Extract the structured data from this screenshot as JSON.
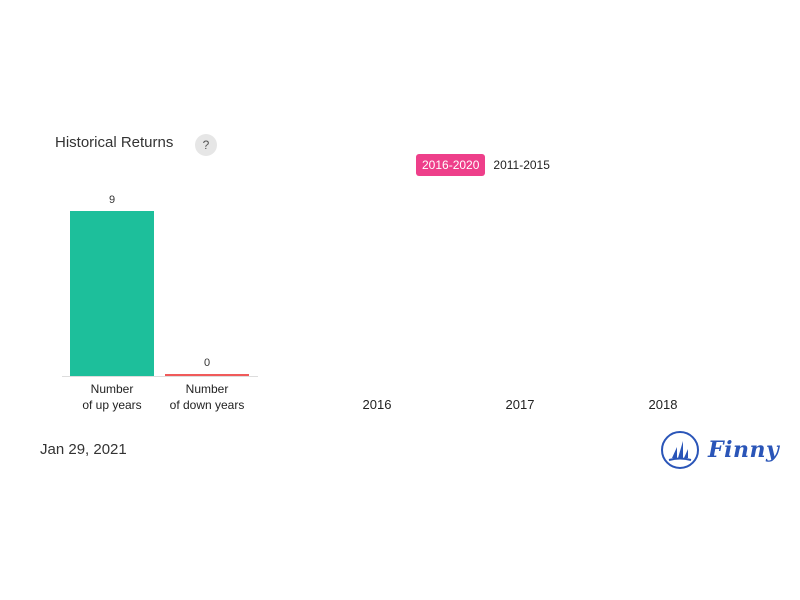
{
  "header": {
    "title": "Historical Returns",
    "help_label": "?"
  },
  "tabs": [
    {
      "label": "2016-2020",
      "active": true
    },
    {
      "label": "2011-2015",
      "active": false
    }
  ],
  "chart_data": {
    "type": "bar",
    "categories": [
      "Number\nof up years",
      "Number\nof down years"
    ],
    "category_lines": [
      [
        "Number",
        "of up years"
      ],
      [
        "Number",
        "of down years"
      ]
    ],
    "values": [
      9,
      0
    ],
    "colors": [
      "#1dbf9b",
      "#f05a5a"
    ],
    "year_labels": [
      "2016",
      "2017",
      "2018"
    ],
    "ylim": [
      0,
      9
    ],
    "title": "",
    "xlabel": "",
    "ylabel": ""
  },
  "footer": {
    "date": "Jan 29, 2021",
    "brand": "Finny"
  }
}
